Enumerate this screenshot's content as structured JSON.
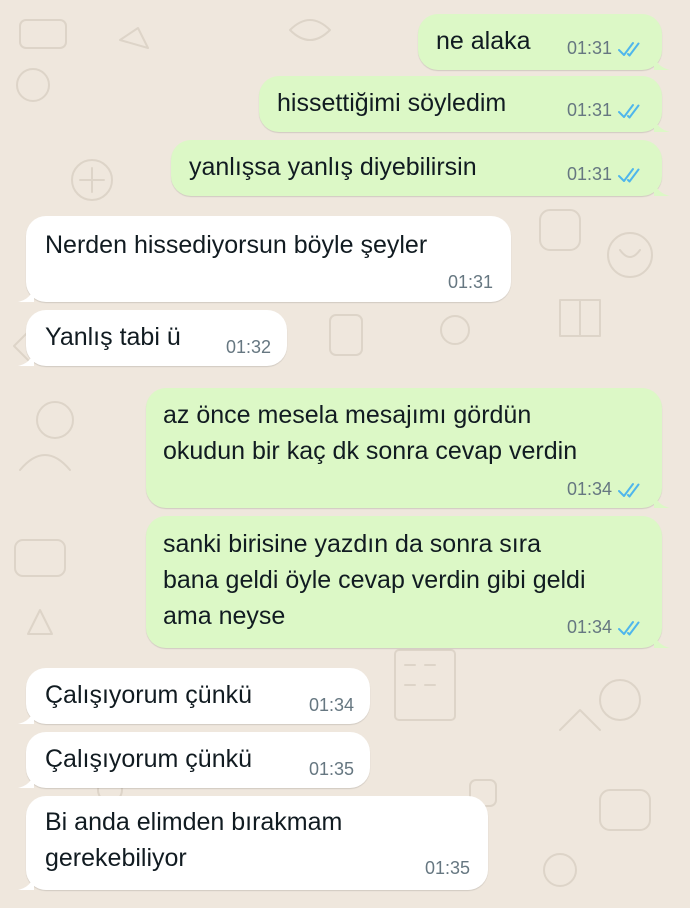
{
  "theme": {
    "outgoing_bubble": "#dcf8c6",
    "incoming_bubble": "#ffffff",
    "wallpaper": "#efe7dd",
    "read_ticks": "#4fb6ec",
    "timestamp": "#667781",
    "text": "#111b21"
  },
  "messages": [
    {
      "direction": "outgoing",
      "text": "ne alaka",
      "time": "01:31",
      "status": "read"
    },
    {
      "direction": "outgoing",
      "text": "hissettiğimi söyledim",
      "time": "01:31",
      "status": "read"
    },
    {
      "direction": "outgoing",
      "text": "yanlışsa yanlış diyebilirsin",
      "time": "01:31",
      "status": "read"
    },
    {
      "direction": "incoming",
      "text": "Nerden hissediyorsun böyle şeyler",
      "time": "01:31"
    },
    {
      "direction": "incoming",
      "text": "Yanlış tabi ü",
      "time": "01:32"
    },
    {
      "direction": "outgoing",
      "text": "az önce mesela mesajımı gördün\nokudun bir kaç dk sonra cevap verdin",
      "time": "01:34",
      "status": "read"
    },
    {
      "direction": "outgoing",
      "text": "sanki birisine yazdın da sonra sıra\nbana geldi öyle cevap verdin gibi geldi\nama neyse",
      "time": "01:34",
      "status": "read"
    },
    {
      "direction": "incoming",
      "text": "Çalışıyorum çünkü",
      "time": "01:34"
    },
    {
      "direction": "incoming",
      "text": "Çalışıyorum çünkü",
      "time": "01:35"
    },
    {
      "direction": "incoming",
      "text": "Bi anda elimden bırakmam\ngerekebiliyor",
      "time": "01:35"
    }
  ],
  "icons": {
    "read_receipt": "double-check-icon"
  }
}
